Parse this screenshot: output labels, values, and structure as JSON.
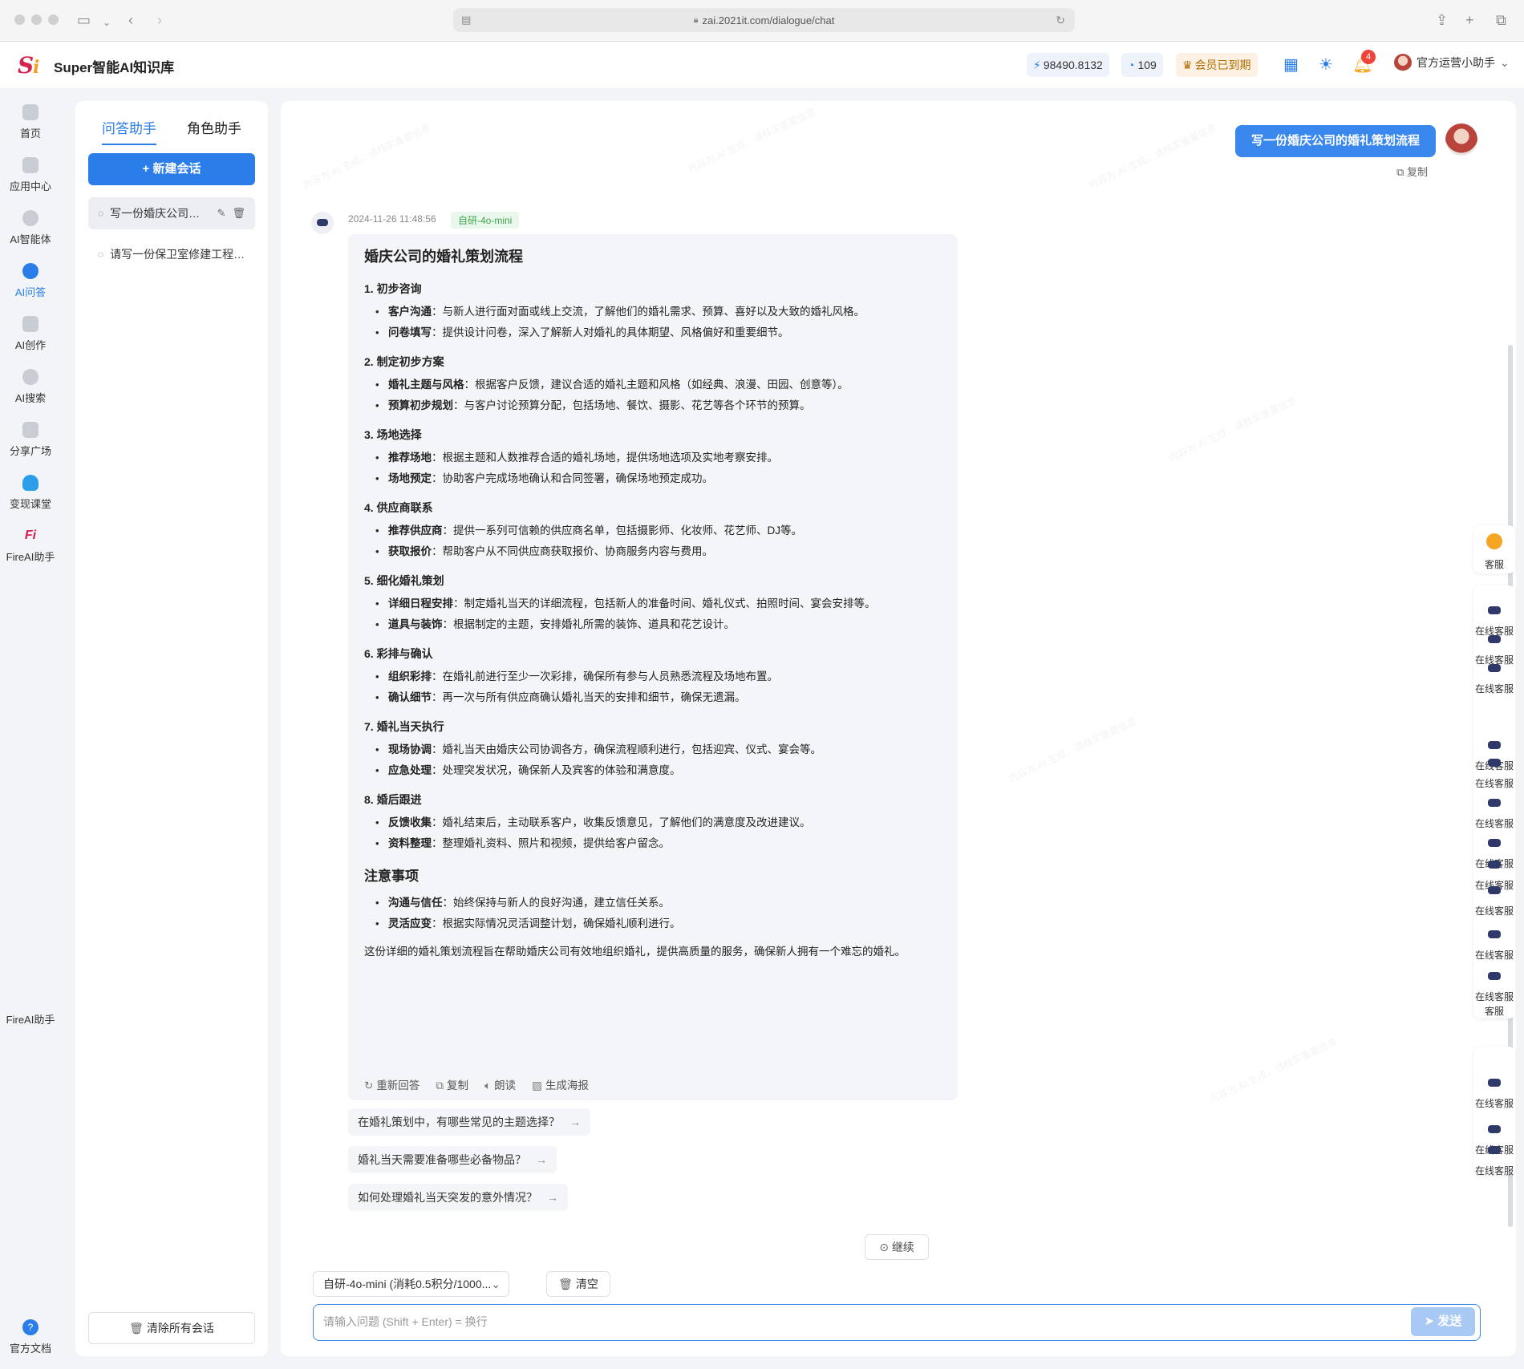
{
  "browser": {
    "url": "zai.2021it.com/dialogue/chat"
  },
  "header": {
    "app_title": "Super智能AI知识库",
    "points": "98490.8132",
    "count": "109",
    "member_status": "会员已到期",
    "notification_count": "4",
    "user_name": "官方运营小助手"
  },
  "nav": {
    "items": [
      {
        "label": "首页"
      },
      {
        "label": "应用中心"
      },
      {
        "label": "AI智能体"
      },
      {
        "label": "AI问答"
      },
      {
        "label": "AI创作"
      },
      {
        "label": "AI搜索"
      },
      {
        "label": "分享广场"
      },
      {
        "label": "变现课堂"
      },
      {
        "label": "FireAI助手"
      }
    ],
    "extra_label": "FireAI助手",
    "docs_label": "官方文档"
  },
  "sessions": {
    "tab_qa": "问答助手",
    "tab_role": "角色助手",
    "new_chat": "+ 新建会话",
    "items": [
      {
        "title": "写一份婚庆公司的婚礼策划流程"
      },
      {
        "title": "请写一份保卫室修建工程方案"
      }
    ],
    "clear_all": "清除所有会话"
  },
  "chat": {
    "user_message": "写一份婚庆公司的婚礼策划流程",
    "copy_label": "复制",
    "timestamp": "2024-11-26 11:48:56",
    "model_tag": "自研-4o-mini",
    "answer": {
      "title": "婚庆公司的婚礼策划流程",
      "sections": [
        {
          "heading": "1. 初步咨询",
          "items": [
            {
              "bold": "客户沟通",
              "text": "：与新人进行面对面或线上交流，了解他们的婚礼需求、预算、喜好以及大致的婚礼风格。"
            },
            {
              "bold": "问卷填写",
              "text": "：提供设计问卷，深入了解新人对婚礼的具体期望、风格偏好和重要细节。"
            }
          ]
        },
        {
          "heading": "2. 制定初步方案",
          "items": [
            {
              "bold": "婚礼主题与风格",
              "text": "：根据客户反馈，建议合适的婚礼主题和风格（如经典、浪漫、田园、创意等）。"
            },
            {
              "bold": "预算初步规划",
              "text": "：与客户讨论预算分配，包括场地、餐饮、摄影、花艺等各个环节的预算。"
            }
          ]
        },
        {
          "heading": "3. 场地选择",
          "items": [
            {
              "bold": "推荐场地",
              "text": "：根据主题和人数推荐合适的婚礼场地，提供场地选项及实地考察安排。"
            },
            {
              "bold": "场地预定",
              "text": "：协助客户完成场地确认和合同签署，确保场地预定成功。"
            }
          ]
        },
        {
          "heading": "4. 供应商联系",
          "items": [
            {
              "bold": "推荐供应商",
              "text": "：提供一系列可信赖的供应商名单，包括摄影师、化妆师、花艺师、DJ等。"
            },
            {
              "bold": "获取报价",
              "text": "：帮助客户从不同供应商获取报价、协商服务内容与费用。"
            }
          ]
        },
        {
          "heading": "5. 细化婚礼策划",
          "items": [
            {
              "bold": "详细日程安排",
              "text": "：制定婚礼当天的详细流程，包括新人的准备时间、婚礼仪式、拍照时间、宴会安排等。"
            },
            {
              "bold": "道具与装饰",
              "text": "：根据制定的主题，安排婚礼所需的装饰、道具和花艺设计。"
            }
          ]
        },
        {
          "heading": "6. 彩排与确认",
          "items": [
            {
              "bold": "组织彩排",
              "text": "：在婚礼前进行至少一次彩排，确保所有参与人员熟悉流程及场地布置。"
            },
            {
              "bold": "确认细节",
              "text": "：再一次与所有供应商确认婚礼当天的安排和细节，确保无遗漏。"
            }
          ]
        },
        {
          "heading": "7. 婚礼当天执行",
          "items": [
            {
              "bold": "现场协调",
              "text": "：婚礼当天由婚庆公司协调各方，确保流程顺利进行，包括迎宾、仪式、宴会等。"
            },
            {
              "bold": "应急处理",
              "text": "：处理突发状况，确保新人及宾客的体验和满意度。"
            }
          ]
        },
        {
          "heading": "8. 婚后跟进",
          "items": [
            {
              "bold": "反馈收集",
              "text": "：婚礼结束后，主动联系客户，收集反馈意见，了解他们的满意度及改进建议。"
            },
            {
              "bold": "资料整理",
              "text": "：整理婚礼资料、照片和视频，提供给客户留念。"
            }
          ]
        }
      ],
      "notes_heading": "注意事项",
      "notes": [
        {
          "bold": "沟通与信任",
          "text": "：始终保持与新人的良好沟通，建立信任关系。"
        },
        {
          "bold": "灵活应变",
          "text": "：根据实际情况灵活调整计划，确保婚礼顺利进行。"
        }
      ],
      "conclusion": "这份详细的婚礼策划流程旨在帮助婚庆公司有效地组织婚礼，提供高质量的服务，确保新人拥有一个难忘的婚礼。"
    },
    "actions": {
      "regenerate": "重新回答",
      "copy": "复制",
      "read": "朗读",
      "poster": "生成海报"
    },
    "suggestions": [
      "在婚礼策划中，有哪些常见的主题选择？",
      "婚礼当天需要准备哪些必备物品？",
      "如何处理婚礼当天突发的意外情况？"
    ],
    "continue_label": "继续",
    "model_select": "自研-4o-mini (消耗0.5积分/1000...",
    "clear_label": "清空",
    "input_placeholder": "请输入问题 (Shift + Enter) = 换行",
    "send_label": "发送"
  },
  "rail": {
    "service_label": "客服",
    "online_labels": [
      "在线客服",
      "在线客服",
      "在线客服",
      "在线客服",
      "在线客服",
      "在线客服",
      "在线客服",
      "在线客服",
      "在线客服",
      "在线客服",
      "在线客服",
      "在线客服",
      "在线客服",
      "在线客服",
      "在线客服"
    ],
    "tail_label": "客服"
  },
  "colors": {
    "accent": "#2b7de9",
    "user_bubble": "#3a87ee",
    "model_tag": "#3fa34d",
    "badge": "#f04438"
  }
}
